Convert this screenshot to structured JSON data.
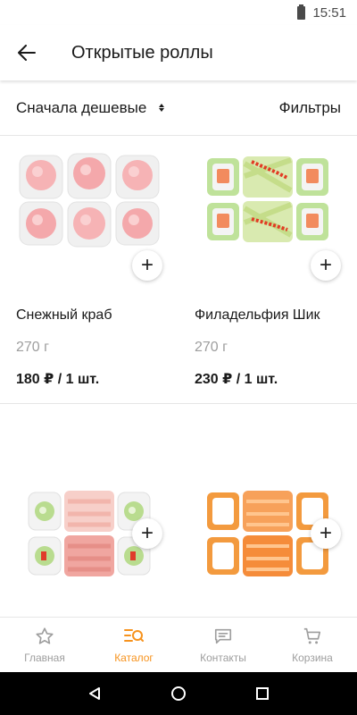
{
  "status_bar": {
    "time": "15:51"
  },
  "header": {
    "title": "Открытые роллы"
  },
  "toolbar": {
    "sort_label": "Сначала дешевые",
    "filters_label": "Фильтры"
  },
  "products": [
    {
      "name": "Снежный краб",
      "weight": "270 г",
      "price": "180 ₽ / 1 шт."
    },
    {
      "name": "Филадельфия Шик",
      "weight": "270 г",
      "price": "230 ₽ / 1 шт."
    }
  ],
  "add_button_label": "+",
  "bottom_nav": {
    "items": [
      {
        "label": "Главная",
        "icon": "star-icon"
      },
      {
        "label": "Каталог",
        "icon": "catalog-icon"
      },
      {
        "label": "Контакты",
        "icon": "chat-icon"
      },
      {
        "label": "Корзина",
        "icon": "cart-icon"
      }
    ],
    "active_index": 1
  },
  "colors": {
    "accent": "#f7931e",
    "muted": "#9e9e9e"
  }
}
